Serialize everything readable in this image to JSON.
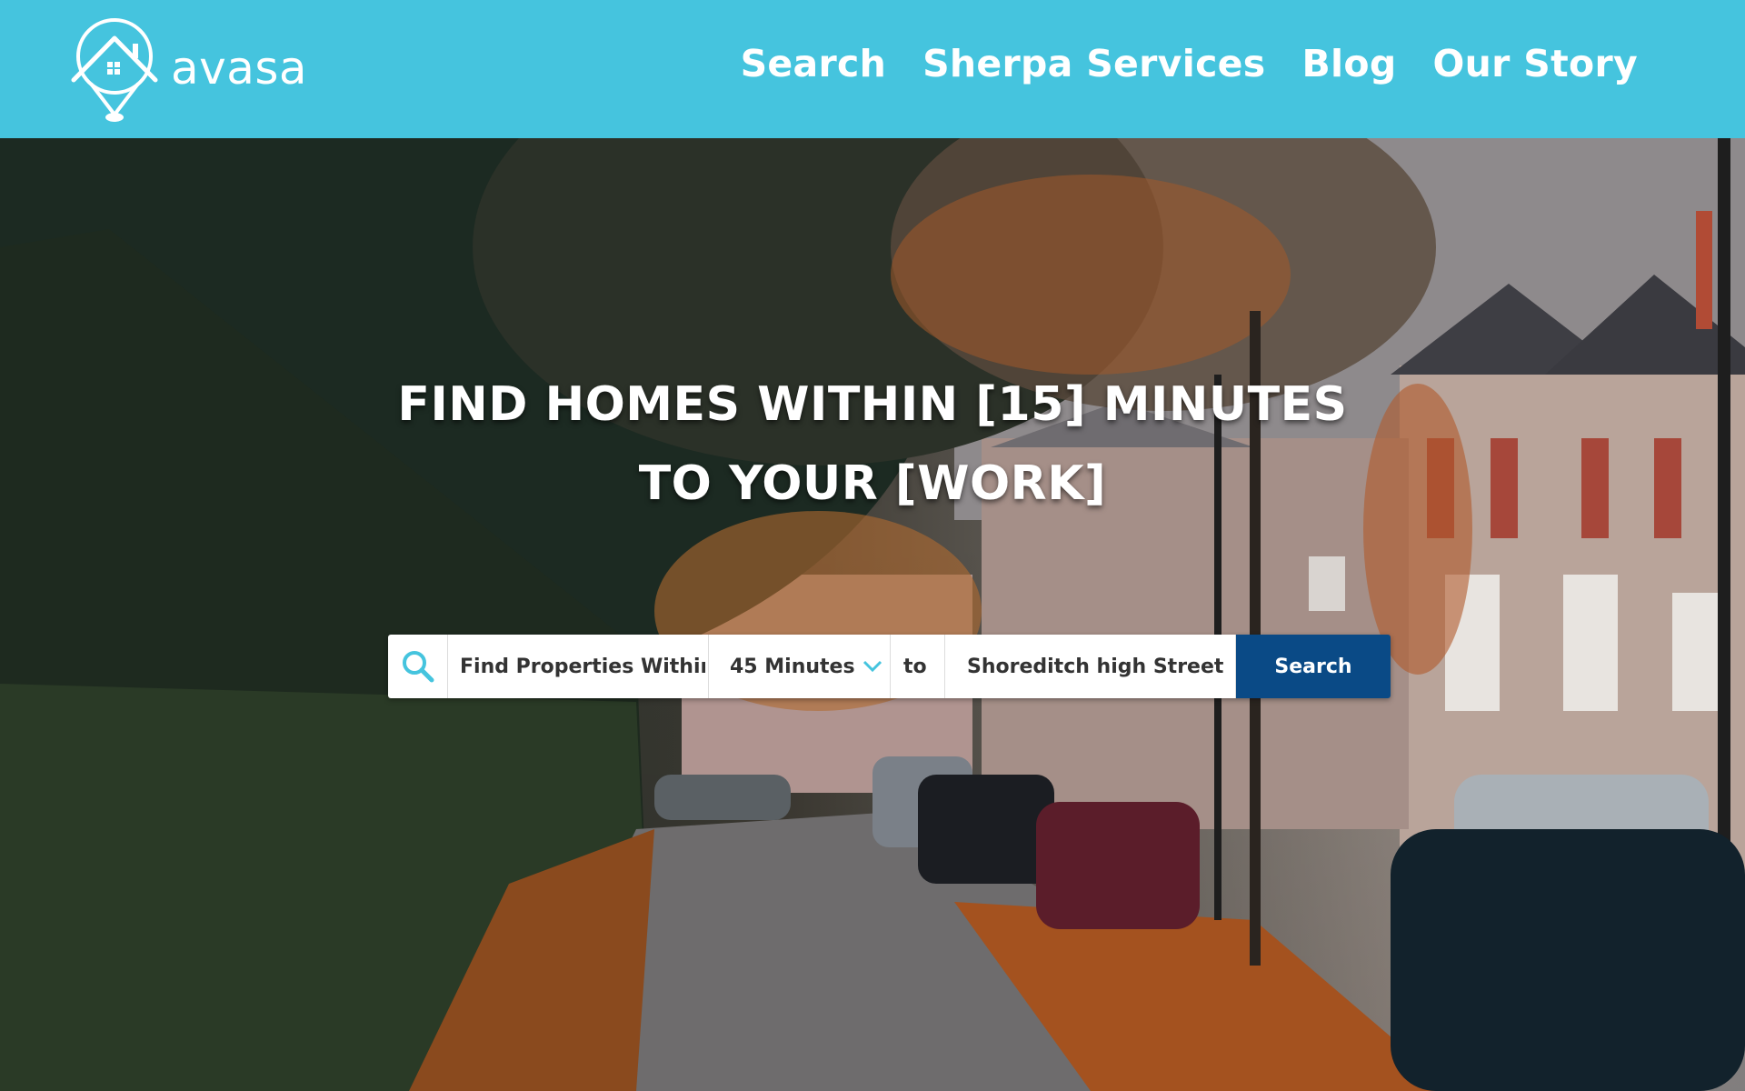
{
  "brand": {
    "name": "avasa"
  },
  "nav": {
    "items": [
      {
        "label": "Search"
      },
      {
        "label": "Sherpa Services"
      },
      {
        "label": "Blog"
      },
      {
        "label": "Our Story"
      }
    ]
  },
  "hero": {
    "headline": "FIND HOMES WITHIN [15] MINUTES TO YOUR [WORK]",
    "image": "autumn-street-with-houses-and-parked-cars"
  },
  "search": {
    "find_label": "Find Properties Within",
    "duration": "45 Minutes",
    "connector": "to",
    "destination": "Shoreditch high Street",
    "button_label": "Search"
  },
  "colors": {
    "header_bg": "#45c4de",
    "search_button": "#0a4a86",
    "accent_icon": "#45c4de"
  },
  "icons": [
    "house-pin-logo-icon",
    "search-icon",
    "chevron-down-icon"
  ]
}
